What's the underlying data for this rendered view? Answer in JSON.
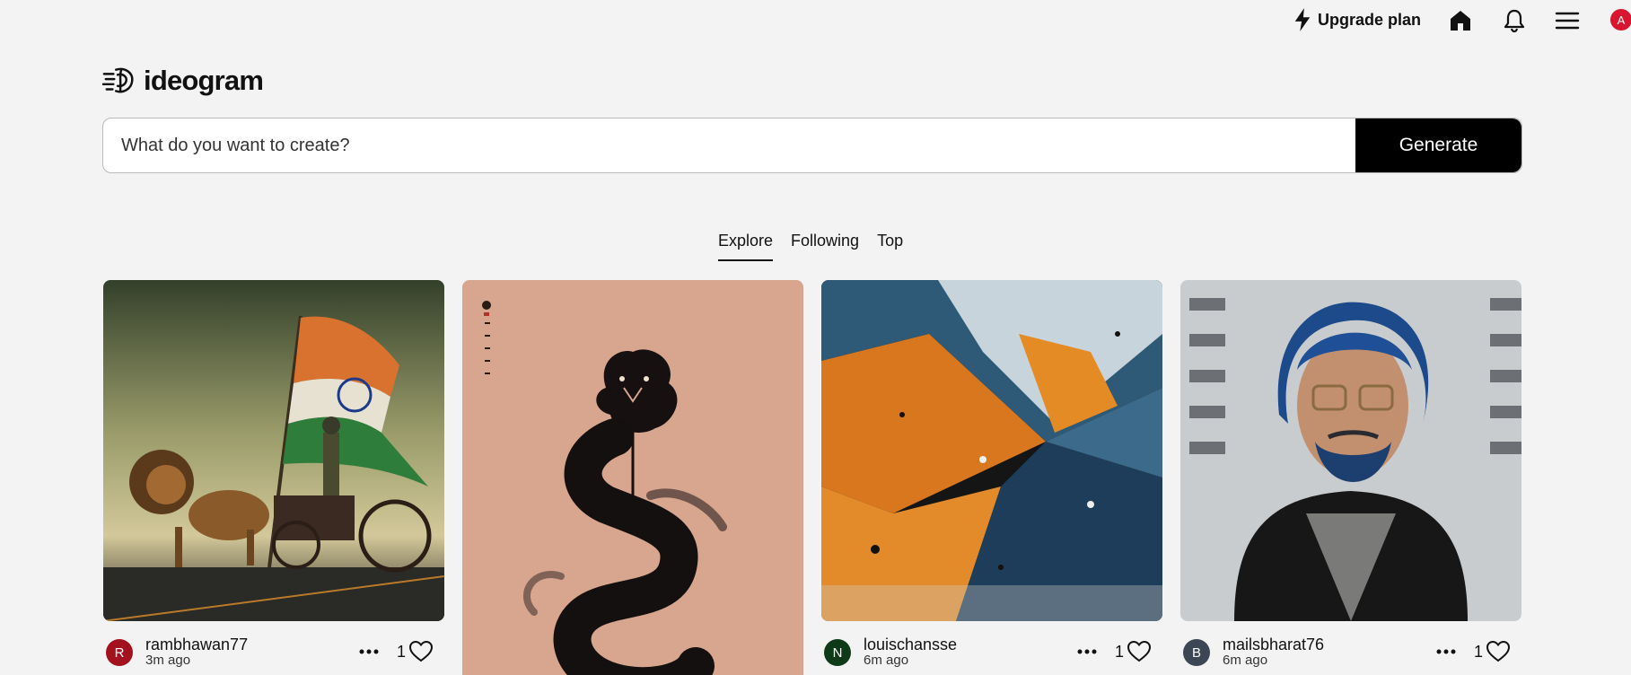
{
  "header": {
    "upgrade_label": "Upgrade plan",
    "home_icon": "home-icon",
    "bell_icon": "bell-icon",
    "menu_icon": "hamburger-menu-icon",
    "user_initial": "A"
  },
  "logo": {
    "text": "ideogram"
  },
  "prompt": {
    "placeholder": "What do you want to create?",
    "generate_label": "Generate"
  },
  "tabs": [
    {
      "label": "Explore",
      "active": true
    },
    {
      "label": "Following",
      "active": false
    },
    {
      "label": "Top",
      "active": false
    }
  ],
  "cards": [
    {
      "username": "rambhawan77",
      "time": "3m ago",
      "likes": "1",
      "avatar_initial": "R",
      "avatar_color": "#a3101e"
    },
    {
      "username": "",
      "time": "",
      "likes": "",
      "avatar_initial": "",
      "avatar_color": ""
    },
    {
      "username": "louischansse",
      "time": "6m ago",
      "likes": "1",
      "avatar_initial": "N",
      "avatar_color": "#0f3a1a"
    },
    {
      "username": "mailsbharat76",
      "time": "6m ago",
      "likes": "1",
      "avatar_initial": "B",
      "avatar_color": "#3c4654"
    }
  ],
  "colors": {
    "accent": "#000000",
    "avatar_user": "#d8162f",
    "background": "#f3f3f3"
  }
}
